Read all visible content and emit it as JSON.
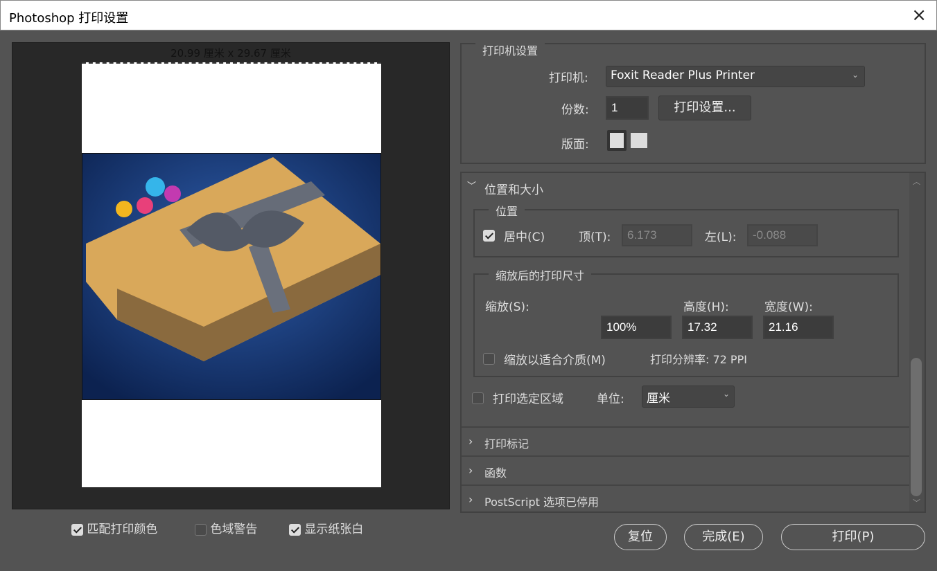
{
  "window": {
    "title": "Photoshop 打印设置",
    "close_icon": "×"
  },
  "preview": {
    "paper_size": "20.99 厘米 x 29.67 厘米"
  },
  "bottom_checks": [
    {
      "label": "匹配打印颜色",
      "checked": true
    },
    {
      "label": "色域警告",
      "checked": false
    },
    {
      "label": "显示纸张白",
      "checked": true
    }
  ],
  "printer_setup": {
    "legend": "打印机设置",
    "printer_label": "打印机:",
    "printer_value": "Foxit Reader Plus Printer",
    "copies_label": "份数:",
    "copies_value": "1",
    "settings_button": "打印设置...",
    "layout_label": "版面:"
  },
  "position_size": {
    "header": "位置和大小",
    "position_legend": "位置",
    "center_label": "居中(C)",
    "center_checked": true,
    "top_label": "顶(T):",
    "top_value": "6.173",
    "left_label": "左(L):",
    "left_value": "-0.088",
    "scaled_legend": "缩放后的打印尺寸",
    "scale_label": "缩放(S):",
    "height_label": "高度(H):",
    "width_label": "宽度(W):",
    "scale_value": "100%",
    "height_value": "17.32",
    "width_value": "21.16",
    "fit_media_label": "缩放以适合介质(M)",
    "fit_media_checked": false,
    "resolution": "打印分辨率: 72 PPI",
    "print_selected_label": "打印选定区域",
    "unit_label": "单位:",
    "unit_value": "厘米"
  },
  "sections": [
    "打印标记",
    "函数",
    "PostScript 选项已停用"
  ],
  "buttons": {
    "reset": "复位",
    "done": "完成(E)",
    "print": "打印(P)"
  },
  "colors": {
    "bg": "#535353",
    "preview_bg": "#282828"
  }
}
